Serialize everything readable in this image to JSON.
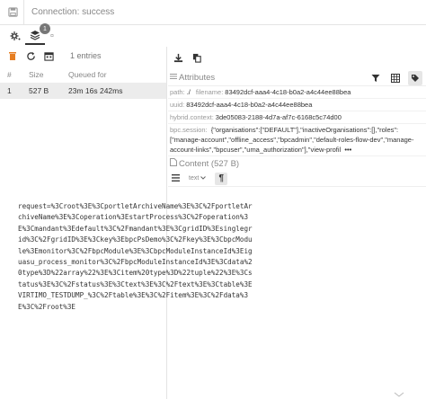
{
  "top_bar": {
    "title": "Connection: success"
  },
  "tool_row": {
    "badge": "1",
    "dd": "¤"
  },
  "left": {
    "entries": "1 entries",
    "columns": [
      "#",
      "Size",
      "Queued for"
    ],
    "rows": [
      {
        "num": "1",
        "size": "527 B",
        "queued": "23m 16s 242ms"
      }
    ]
  },
  "right": {
    "attributes_title": "Attributes",
    "path_key": "path:",
    "path_val": "./",
    "filename_key": "filename:",
    "filename_val": "83492dcf-aaa4-4c18-b0a2-a4c44ee88bea",
    "uuid_key": "uuid:",
    "uuid_val": "83492dcf-aaa4-4c18-b0a2-a4c44ee88bea",
    "hybrid_key": "hybrid.context:",
    "hybrid_val": "3de05083-2188-4d7a-af7c-6168c5c74d00",
    "session_key": "bpc.session:",
    "session_val": "{\"organisations\":[\"DEFAULT\"],\"inactiveOrganisations\":[],\"roles\":[\"manage-account\",\"offline_access\",\"bpcadmin\",\"default-roles-flow-dev\",\"manage-account-links\",\"bpcuser\",\"uma_authorization\"],\"view-profil",
    "session_more": "•••",
    "content_title": "Content (527 B)",
    "text_select": "text",
    "content_text": "request=%3Croot%3E%3CportletArchiveName%3E%3C%2FportletArchiveName%3E%3Coperation%3EstartProcess%3C%2Foperation%3E%3Cmandant%3Edefault%3C%2Fmandant%3E%3CgridID%3Esinglegrid%3C%2FgridID%3E%3Ckey%3EbpcPsDemo%3C%2Fkey%3E%3CbpcModule%3Emonitor%3C%2FbpcModule%3E%3CbpcModuleInstanceId%3Eiguasu_process_monitor%3C%2FbpcModuleInstanceId%3E%3Cdata%20type%3D%22array%22%3E%3Citem%20type%3D%22tuple%22%3E%3Cstatus%3E%3C%2Fstatus%3E%3Ctext%3E%3C%2Ftext%3E%3Ctable%3EVIRTIMO_TESTDUMP_%3C%2Ftable%3E%3C%2Fitem%3E%3C%2Fdata%3E%3C%2Froot%3E"
  }
}
